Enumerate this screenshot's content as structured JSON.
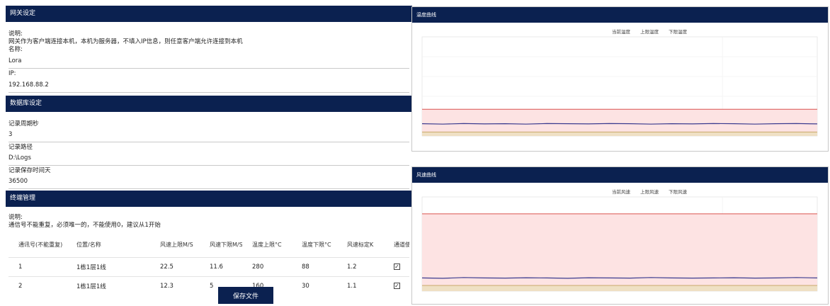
{
  "gateway": {
    "header": "网关设定",
    "desc_label": "说明:",
    "desc_text": "网关作为客户端连接本机，本机为服务器，不填入IP信息，则任意客户端允许连接到本机",
    "name_label": "名称:",
    "name_value": "Lora",
    "ip_label": "IP:",
    "ip_value": "192.168.88.2"
  },
  "database": {
    "header": "数据库设定",
    "period_label": "记录周期秒",
    "period_value": "3",
    "path_label": "记录路径",
    "path_value": "D:\\Logs",
    "keep_label": "记录保存时间天",
    "keep_value": "36500"
  },
  "terminal": {
    "header": "终端管理",
    "desc_label": "说明:",
    "desc_text": "通信号不能重复，必须唯一的，不能使用0，建议从1开始",
    "columns": [
      "通讯号(不能重复)",
      "位置/名称",
      "风速上限M/S",
      "风速下限M/S",
      "温度上限°C",
      "温度下限°C",
      "风速标定K",
      "通道使用"
    ],
    "rows": [
      [
        "1",
        "1栋1层1线",
        "22.5",
        "11.6",
        "280",
        "88",
        "1.2",
        "✓"
      ],
      [
        "2",
        "1栋1层1线",
        "12.3",
        "5",
        "160",
        "30",
        "1.1",
        "✓"
      ]
    ],
    "save_label": "保存文件"
  },
  "temp_chart": {
    "header": "温度曲线",
    "legend": [
      "当前温度",
      "上限温度",
      "下限温度"
    ]
  },
  "wind_chart": {
    "header": "风速曲线",
    "legend": [
      "当前风速",
      "上限风速",
      "下限风速"
    ]
  },
  "chart_data": [
    {
      "type": "line",
      "title": "温度曲线",
      "legend": [
        "当前温度",
        "上限温度",
        "下限温度"
      ],
      "ylim": [
        0,
        5
      ],
      "series": [
        {
          "name": "当前温度",
          "color": "#3b3b8f",
          "values": [
            0.62,
            0.6,
            0.63,
            0.61,
            0.62,
            0.6,
            0.63,
            0.62,
            0.61,
            0.63,
            0.62,
            0.6,
            0.62,
            0.61,
            0.63,
            0.62,
            0.6,
            0.62,
            0.63,
            0.61
          ]
        },
        {
          "name": "上限温度",
          "color": "#d9534f",
          "values": [
            1.35,
            1.35,
            1.35,
            1.35,
            1.35,
            1.35,
            1.35,
            1.35,
            1.35,
            1.35,
            1.35,
            1.35,
            1.35,
            1.35,
            1.35,
            1.35,
            1.35,
            1.35,
            1.35,
            1.35
          ]
        },
        {
          "name": "下限温度",
          "color": "#c9a96b",
          "values": [
            0.2,
            0.2,
            0.2,
            0.2,
            0.2,
            0.2,
            0.2,
            0.2,
            0.2,
            0.2,
            0.2,
            0.2,
            0.2,
            0.2,
            0.2,
            0.2,
            0.2,
            0.2,
            0.2,
            0.2
          ]
        }
      ]
    },
    {
      "type": "line",
      "title": "风速曲线",
      "legend": [
        "当前风速",
        "上限风速",
        "下限风速"
      ],
      "ylim": [
        0,
        5
      ],
      "series": [
        {
          "name": "当前风速",
          "color": "#3b3b8f",
          "values": [
            0.7,
            0.68,
            0.72,
            0.7,
            0.69,
            0.71,
            0.7,
            0.68,
            0.71,
            0.7,
            0.69,
            0.72,
            0.7,
            0.69,
            0.7,
            0.71,
            0.69,
            0.7,
            0.72,
            0.7
          ]
        },
        {
          "name": "上限风速",
          "color": "#d9534f",
          "values": [
            4.1,
            4.1,
            4.1,
            4.1,
            4.1,
            4.1,
            4.1,
            4.1,
            4.1,
            4.1,
            4.1,
            4.1,
            4.1,
            4.1,
            4.1,
            4.1,
            4.1,
            4.1,
            4.1,
            4.1
          ]
        },
        {
          "name": "下限风速",
          "color": "#c9a96b",
          "values": [
            0.3,
            0.3,
            0.3,
            0.3,
            0.3,
            0.3,
            0.3,
            0.3,
            0.3,
            0.3,
            0.3,
            0.3,
            0.3,
            0.3,
            0.3,
            0.3,
            0.3,
            0.3,
            0.3,
            0.3
          ]
        }
      ]
    }
  ]
}
